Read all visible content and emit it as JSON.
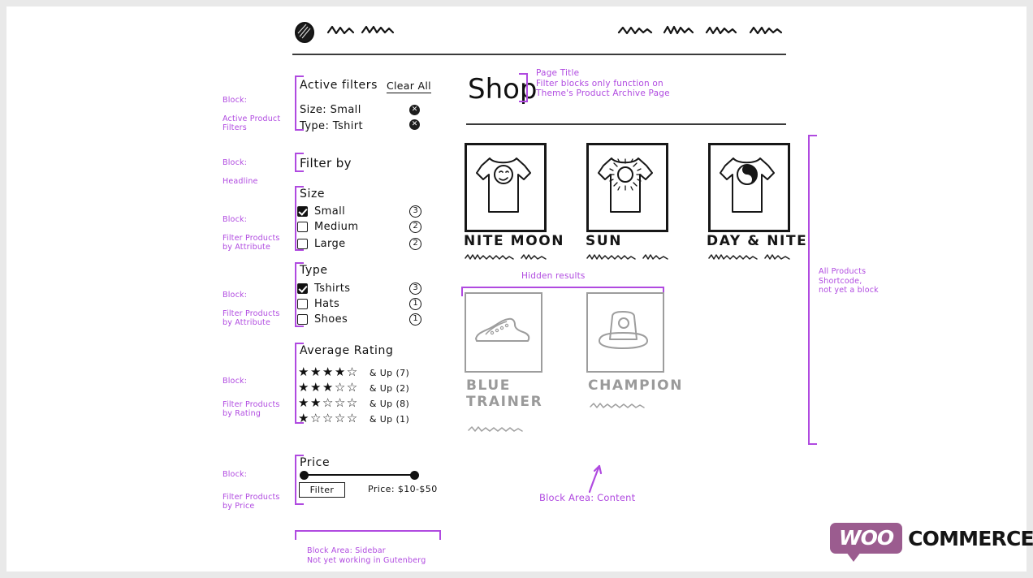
{
  "page": {
    "background": "#ffffff",
    "frame_color": "#e9e9e9",
    "annotation_color": "#b04ae0",
    "ink_color": "#111111",
    "ghost_color": "#9d9d9d"
  },
  "header": {
    "logo_icon": "scribble-circle-logo",
    "site_title_scribbles": 2,
    "nav_scribbles": 4
  },
  "sidebar_annotations": [
    {
      "label": "Block:",
      "detail": "Active Product\nFilters"
    },
    {
      "label": "Block:",
      "detail": "Headline"
    },
    {
      "label": "Block:",
      "detail": "Filter Products\nby Attribute"
    },
    {
      "label": "Block:",
      "detail": "Filter Products\nby Attribute"
    },
    {
      "label": "Block:",
      "detail": "Filter Products\nby Rating"
    },
    {
      "label": "Block:",
      "detail": "Filter Products\nby Price"
    }
  ],
  "active_filters": {
    "title": "Active filters",
    "clear_all_label": "Clear All",
    "remove_icon": "close-circle-icon",
    "items": [
      {
        "label": "Size: Small"
      },
      {
        "label": "Type: Tshirt"
      }
    ]
  },
  "headline": {
    "text": "Filter by"
  },
  "filter_size": {
    "title": "Size",
    "options": [
      {
        "label": "Small",
        "count": "3",
        "checked": true
      },
      {
        "label": "Medium",
        "count": "2",
        "checked": false
      },
      {
        "label": "Large",
        "count": "2",
        "checked": false
      }
    ]
  },
  "filter_type": {
    "title": "Type",
    "options": [
      {
        "label": "Tshirts",
        "count": "3",
        "checked": true
      },
      {
        "label": "Hats",
        "count": "1",
        "checked": false
      },
      {
        "label": "Shoes",
        "count": "1",
        "checked": false
      }
    ]
  },
  "filter_rating": {
    "title": "Average Rating",
    "rows": [
      {
        "filled": 4,
        "empty": 1,
        "label": "& Up (7)"
      },
      {
        "filled": 3,
        "empty": 2,
        "label": "& Up (2)"
      },
      {
        "filled": 2,
        "empty": 3,
        "label": "& Up (8)"
      },
      {
        "filled": 1,
        "empty": 4,
        "label": "& Up (1)"
      }
    ]
  },
  "filter_price": {
    "title": "Price",
    "button_label": "Filter",
    "range_label": "Price: $10-$50"
  },
  "sidebar_area_note": "Block Area: Sidebar\nNot yet working in Gutenberg",
  "content": {
    "page_title": "Shop",
    "page_title_note": "Page Title\nFilter blocks only function on\nTheme's Product Archive Page",
    "hidden_results_note": "Hidden results",
    "content_area_note": "Block Area: Content",
    "all_products_note": "All Products\nShortcode,\nnot yet a block",
    "visible_products": [
      {
        "name": "NITE MOON",
        "art": "tshirt-moon-face"
      },
      {
        "name": "SUN",
        "art": "tshirt-sun"
      },
      {
        "name": "DAY & NITE",
        "art": "tshirt-yin-yang"
      }
    ],
    "hidden_products": [
      {
        "name": "BLUE TRAINER",
        "art": "sneaker"
      },
      {
        "name": "CHAMPION",
        "art": "hat"
      }
    ]
  },
  "footer": {
    "brand_primary": "WOO",
    "brand_secondary": "COMMERCE",
    "brand_color": "#9b5c8f"
  }
}
